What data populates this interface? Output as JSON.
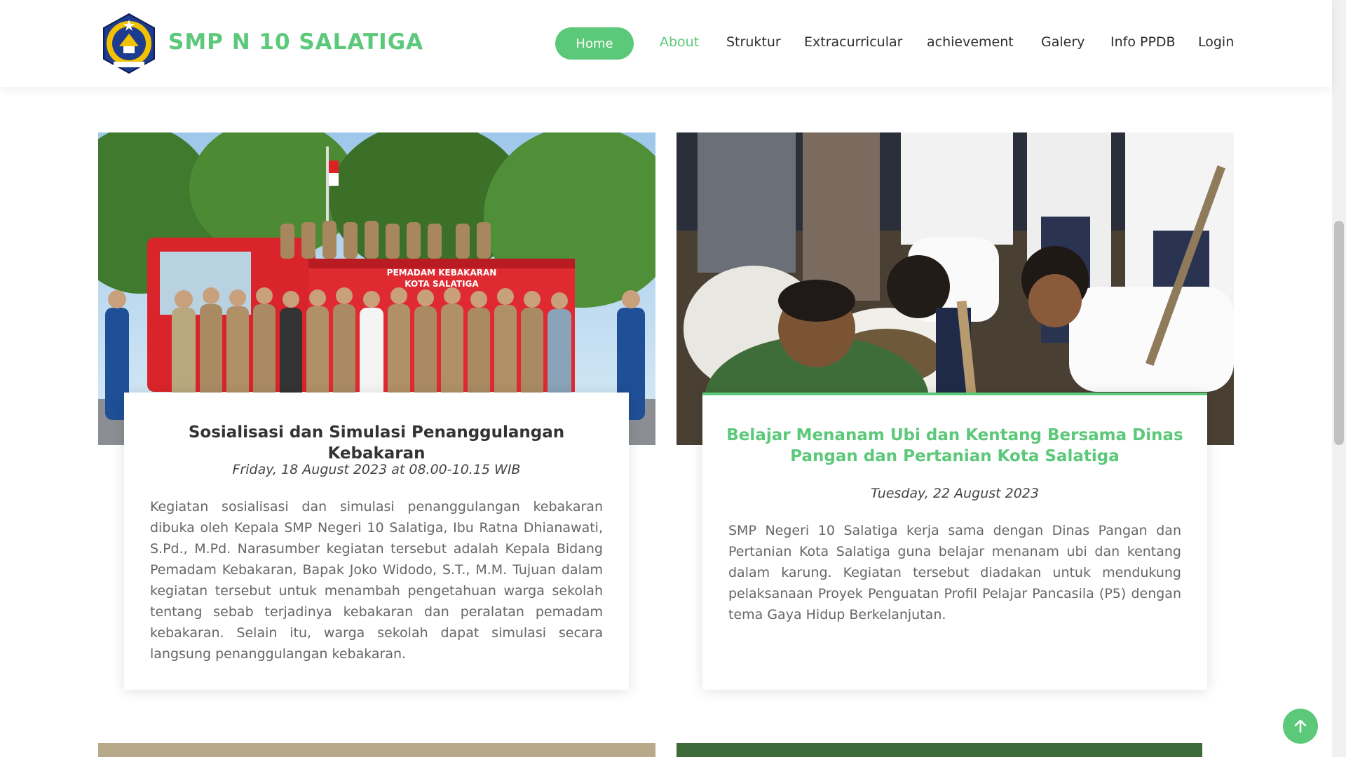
{
  "header": {
    "brand": "SMP N 10 SALATIGA",
    "logo_icon": "school-crest-logo",
    "nav": [
      {
        "label": "Home",
        "active": true
      },
      {
        "label": "About"
      },
      {
        "label": "Struktur"
      },
      {
        "label": "Extracurricular"
      },
      {
        "label": "achievement"
      },
      {
        "label": "Galery"
      },
      {
        "label": "Info PPDB"
      },
      {
        "label": "Login"
      }
    ]
  },
  "posts": [
    {
      "image_icon": "fire-truck-group-photo",
      "title": "Sosialisasi dan Simulasi Penanggulangan Kebakaran",
      "date": "Friday, 18 August 2023 at 08.00-10.15 WIB",
      "body": "Kegiatan sosialisasi dan simulasi penanggulangan kebakaran dibuka oleh Kepala SMP Negeri 10 Salatiga, Ibu Ratna Dhianawati, S.Pd., M.Pd. Narasumber kegiatan tersebut adalah Kepala Bidang Pemadam Kebakaran, Bapak Joko Widodo, S.T., M.M. Tujuan dalam kegiatan tersebut untuk menambah pengetahuan warga sekolah tentang sebab terjadinya kebakaran dan peralatan pemadam kebakaran. Selain itu, warga sekolah dapat simulasi secara langsung penanggulangan kebakaran."
    },
    {
      "image_icon": "students-planting-photo",
      "title": "Belajar Menanam Ubi dan Kentang Bersama Dinas Pangan dan Pertanian Kota Salatiga",
      "date": "Tuesday, 22 August 2023",
      "body": "SMP Negeri 10 Salatiga kerja sama dengan Dinas Pangan dan Pertanian Kota Salatiga guna belajar menanam ubi dan kentang dalam karung. Kegiatan tersebut diadakan untuk mendukung pelaksanaan Proyek Penguatan Profil Pelajar Pancasila (P5) dengan tema Gaya Hidup Berkelanjutan."
    }
  ],
  "truck_sign": "PEMADAM KEBAKARAN\nKOTA SALATIGA",
  "colors": {
    "accent": "#5cc879",
    "text": "#333333"
  },
  "back_to_top_icon": "arrow-up-icon"
}
